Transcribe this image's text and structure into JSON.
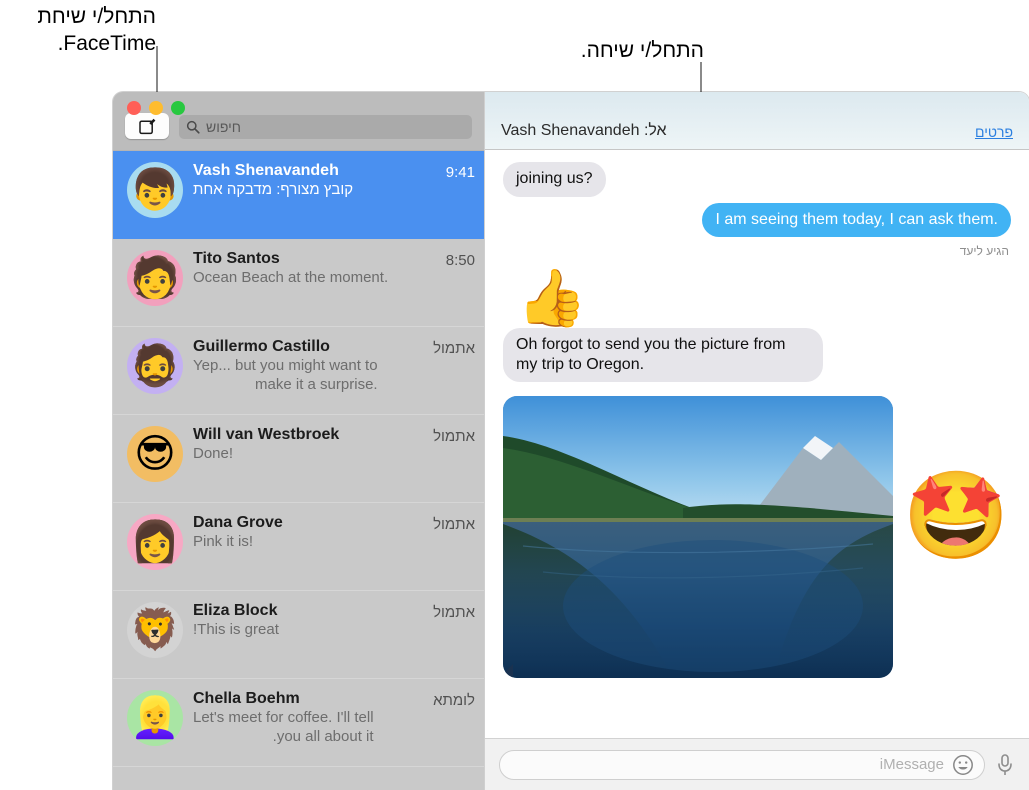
{
  "annotations": {
    "facetime_callout": "התחל/י שיחת\nFaceTime.",
    "start_conversation_callout": "התחל/י שיחה."
  },
  "window": {
    "traffic_lights": {
      "green_label": "zoom",
      "yellow_label": "minimize",
      "red_label": "close",
      "green_color": "#28c840",
      "yellow_color": "#febc2e",
      "red_color": "#ff5f57"
    }
  },
  "sidebar": {
    "search": {
      "placeholder": "חיפוש",
      "icon": "search-icon"
    },
    "compose": {
      "label": "",
      "icon": "compose-icon"
    },
    "conversations": [
      {
        "name": "Vash Shenavandeh",
        "preview": "קובץ מצורף: מדבקה אחת",
        "time": "9:41",
        "selected": true,
        "avatar_emoji": "👦",
        "avatar_bg": "#a8dcf0"
      },
      {
        "name": "Tito Santos",
        "preview": ".Ocean Beach at the moment",
        "time": "8:50",
        "selected": false,
        "avatar_emoji": "🧑",
        "avatar_bg": "#f2a0bd"
      },
      {
        "name": "Guillermo Castillo",
        "preview": "Yep... but you might want to\n.make it a surprise",
        "time": "אתמול",
        "selected": false,
        "avatar_emoji": "🧔",
        "avatar_bg": "#c3b0f2"
      },
      {
        "name": "Will van Westbroek",
        "preview": "!Done",
        "time": "אתמול",
        "selected": false,
        "avatar_emoji": "😎",
        "avatar_bg": "#f2bd63"
      },
      {
        "name": "Dana Grove",
        "preview": "!Pink it is",
        "time": "אתמול",
        "selected": false,
        "avatar_emoji": "👩",
        "avatar_bg": "#f7a8c4"
      },
      {
        "name": "Eliza Block",
        "preview": "This is great!",
        "time": "אתמול",
        "selected": false,
        "avatar_emoji": "🦁",
        "avatar_bg": "#d3d3d3"
      },
      {
        "name": "Chella Boehm",
        "preview": "Let's meet for coffee. I'll tell\nyou all about it.",
        "time": "לומתא",
        "selected": false,
        "avatar_emoji": "👱‍♀️",
        "avatar_bg": "#a9e5a4"
      }
    ]
  },
  "conversation": {
    "to_label": "אל:",
    "to_name": "Vash Shenavandeh",
    "details_link": "פרטים",
    "messages": [
      {
        "type": "text",
        "direction": "incoming",
        "text": "joining us?"
      },
      {
        "type": "text",
        "direction": "outgoing",
        "text": "I am seeing them today, I can ask them."
      },
      {
        "type": "status",
        "text": "הגיע ליעד"
      },
      {
        "type": "reaction",
        "emoji": "👍"
      },
      {
        "type": "text",
        "direction": "incoming",
        "text": "Oh forgot to send you the picture from my trip to Oregon."
      },
      {
        "type": "photo",
        "direction": "incoming",
        "caption": "Trillium Lake with Mount Hood, forested shoreline reflected in calm blue water"
      },
      {
        "type": "sticker",
        "emoji": "🤩",
        "direction": "incoming"
      }
    ],
    "composer": {
      "placeholder": "iMessage",
      "mic_icon": "microphone-icon",
      "emoji_icon": "emoji-smiley-icon"
    }
  }
}
